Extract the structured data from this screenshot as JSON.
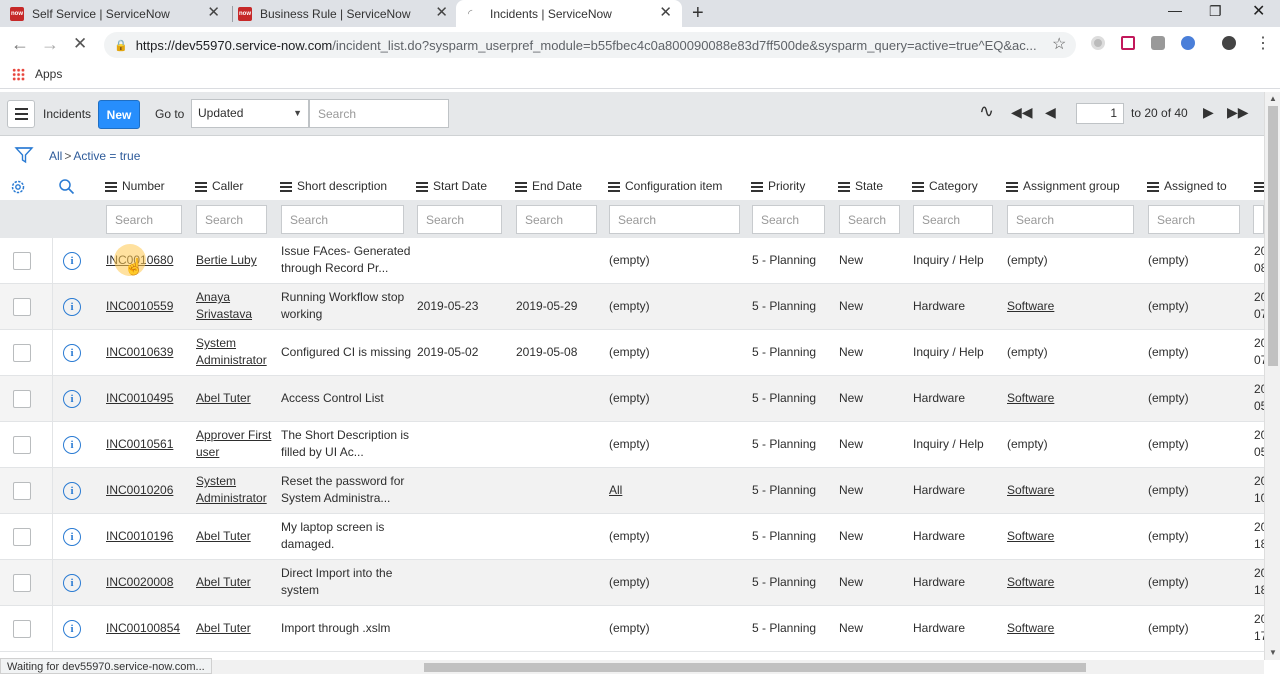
{
  "browser": {
    "tabs": [
      {
        "title": "Self Service | ServiceNow",
        "fav": "now"
      },
      {
        "title": "Business Rule | ServiceNow",
        "fav": "now"
      },
      {
        "title": "Incidents | ServiceNow",
        "fav": ""
      }
    ],
    "url_host": "https://dev55970.service-now.com",
    "url_rest": "/incident_list.do?sysparm_userpref_module=b55fbec4c0a800090088e83d7ff500de&sysparm_query=active=true^EQ&ac...",
    "bookmarks_label": "Apps",
    "status": "Waiting for dev55970.service-now.com..."
  },
  "list": {
    "title": "Incidents",
    "new_label": "New",
    "goto_label": "Go to",
    "goto_value": "Updated",
    "search_placeholder": "Search",
    "page_value": "1",
    "page_range": "to 20 of 40",
    "breadcrumb_all": "All",
    "breadcrumb_sep": ">",
    "breadcrumb_filter": "Active = true"
  },
  "columns": [
    "Number",
    "Caller",
    "Short description",
    "Start Date",
    "End Date",
    "Configuration item",
    "Priority",
    "State",
    "Category",
    "Assignment group",
    "Assigned to"
  ],
  "column_search_placeholder": "Search",
  "rows": [
    {
      "number": "INC0010680",
      "caller": [
        "Bertie Luby"
      ],
      "desc": [
        "Issue FAces- Generated",
        "through Record Pr..."
      ],
      "start": "",
      "end": "",
      "ci": "(empty)",
      "ci_link": false,
      "priority": "5 - Planning",
      "state": "New",
      "category": "Inquiry / Help",
      "group": "(empty)",
      "group_link": false,
      "assigned": "(empty)",
      "updated": [
        "20",
        "08"
      ]
    },
    {
      "number": "INC0010559",
      "caller": [
        "Anaya",
        "Srivastava"
      ],
      "desc": [
        "Running Workflow stop",
        "working"
      ],
      "start": "2019-05-23",
      "end": "2019-05-29",
      "ci": "(empty)",
      "ci_link": false,
      "priority": "5 - Planning",
      "state": "New",
      "category": "Hardware",
      "group": "Software",
      "group_link": true,
      "assigned": "(empty)",
      "updated": [
        "20",
        "07"
      ]
    },
    {
      "number": "INC0010639",
      "caller": [
        "System",
        "Administrator"
      ],
      "desc": [
        "Configured CI is missing"
      ],
      "start": "2019-05-02",
      "end": "2019-05-08",
      "ci": "(empty)",
      "ci_link": false,
      "priority": "5 - Planning",
      "state": "New",
      "category": "Inquiry / Help",
      "group": "(empty)",
      "group_link": false,
      "assigned": "(empty)",
      "updated": [
        "20",
        "07"
      ]
    },
    {
      "number": "INC0010495",
      "caller": [
        "Abel Tuter"
      ],
      "desc": [
        "Access Control List"
      ],
      "start": "",
      "end": "",
      "ci": "(empty)",
      "ci_link": false,
      "priority": "5 - Planning",
      "state": "New",
      "category": "Hardware",
      "group": "Software",
      "group_link": true,
      "assigned": "(empty)",
      "updated": [
        "20",
        "05"
      ]
    },
    {
      "number": "INC0010561",
      "caller": [
        "Approver First",
        "user"
      ],
      "desc": [
        "The Short Description is",
        "filled by UI Ac..."
      ],
      "start": "",
      "end": "",
      "ci": "(empty)",
      "ci_link": false,
      "priority": "5 - Planning",
      "state": "New",
      "category": "Inquiry / Help",
      "group": "(empty)",
      "group_link": false,
      "assigned": "(empty)",
      "updated": [
        "20",
        "05"
      ]
    },
    {
      "number": "INC0010206",
      "caller": [
        "System",
        "Administrator"
      ],
      "desc": [
        "Reset the password for",
        "System Administra..."
      ],
      "start": "",
      "end": "",
      "ci": "All",
      "ci_link": true,
      "priority": "5 - Planning",
      "state": "New",
      "category": "Hardware",
      "group": "Software",
      "group_link": true,
      "assigned": "(empty)",
      "updated": [
        "20",
        "10"
      ]
    },
    {
      "number": "INC0010196",
      "caller": [
        "Abel Tuter"
      ],
      "desc": [
        "My laptop screen is",
        "damaged."
      ],
      "start": "",
      "end": "",
      "ci": "(empty)",
      "ci_link": false,
      "priority": "5 - Planning",
      "state": "New",
      "category": "Hardware",
      "group": "Software",
      "group_link": true,
      "assigned": "(empty)",
      "updated": [
        "20",
        "18"
      ]
    },
    {
      "number": "INC0020008",
      "caller": [
        "Abel Tuter"
      ],
      "desc": [
        "Direct Import into the",
        "system"
      ],
      "start": "",
      "end": "",
      "ci": "(empty)",
      "ci_link": false,
      "priority": "5 - Planning",
      "state": "New",
      "category": "Hardware",
      "group": "Software",
      "group_link": true,
      "assigned": "(empty)",
      "updated": [
        "20",
        "18"
      ]
    },
    {
      "number": "INC00100854",
      "caller": [
        "Abel Tuter"
      ],
      "desc": [
        "Import through .xslm"
      ],
      "start": "",
      "end": "",
      "ci": "(empty)",
      "ci_link": false,
      "priority": "5 - Planning",
      "state": "New",
      "category": "Hardware",
      "group": "Software",
      "group_link": true,
      "assigned": "(empty)",
      "updated": [
        "20",
        "17"
      ]
    }
  ],
  "colors": {
    "accent": "#278efc",
    "header_bg": "#e6e8ea",
    "info_icon": "#2a7bd3",
    "tab_strip": "#dee1e6"
  }
}
